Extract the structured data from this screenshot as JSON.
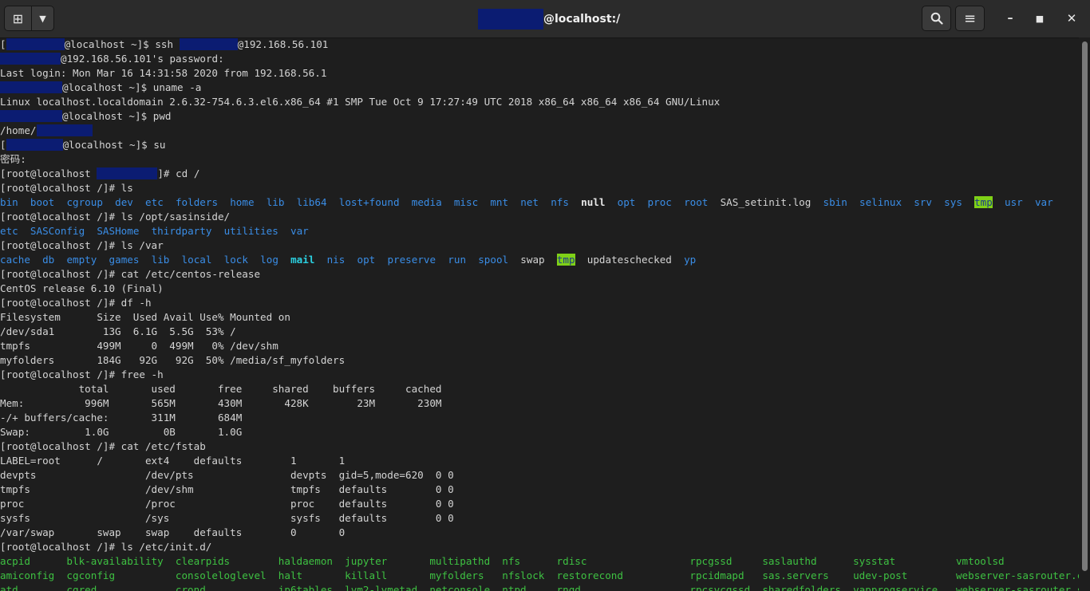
{
  "window": {
    "title": "@localhost:/"
  },
  "titlebar": {
    "new_tab_icon": "new-tab-icon",
    "tab_menu_icon": "chevron-down-icon",
    "search_icon": "search-icon",
    "menu_icon": "hamburger-icon"
  },
  "terminal": {
    "l01_a": "[",
    "l01_b": "@localhost ~]$ ssh ",
    "l01_c": "@192.168.56.101",
    "l02_a": "@192.168.56.101's password:",
    "l03": "Last login: Mon Mar 16 14:31:58 2020 from 192.168.56.1",
    "l04_a": "@localhost ~]$ uname -a",
    "l05": "Linux localhost.localdomain 2.6.32-754.6.3.el6.x86_64 #1 SMP Tue Oct 9 17:27:49 UTC 2018 x86_64 x86_64 x86_64 GNU/Linux",
    "l06_a": "@localhost ~]$ pwd",
    "l07_a": "/home/",
    "l08_a": "[",
    "l08_b": "@localhost ~]$ su",
    "l09": "密码:",
    "l10_a": "[root@localhost ",
    "l10_b": "]# cd /",
    "l11": "[root@localhost /]# ls",
    "ls_root": [
      "bin",
      "boot",
      "cgroup",
      "dev",
      "etc",
      "folders",
      "home",
      "lib",
      "lib64",
      "lost+found",
      "media",
      "misc",
      "mnt",
      "net",
      "nfs"
    ],
    "ls_root_null": "null",
    "ls_root_2": [
      "opt",
      "proc",
      "root"
    ],
    "ls_root_log": "SAS_setinit.log",
    "ls_root_3": [
      "sbin",
      "selinux",
      "srv",
      "sys"
    ],
    "ls_root_tmp": "tmp",
    "ls_root_4": [
      "usr",
      "var"
    ],
    "l13": "[root@localhost /]# ls /opt/sasinside/",
    "ls_sas": [
      "etc",
      "SASConfig",
      "SASHome",
      "thirdparty",
      "utilities",
      "var"
    ],
    "l15": "[root@localhost /]# ls /var",
    "ls_var_1": [
      "cache",
      "db",
      "empty",
      "games",
      "lib",
      "local",
      "lock",
      "log"
    ],
    "ls_var_mail": "mail",
    "ls_var_2": [
      "nis",
      "opt",
      "preserve",
      "run",
      "spool"
    ],
    "ls_var_swap": "swap",
    "ls_var_tmp": "tmp",
    "ls_var_upd": "updateschecked",
    "ls_var_yp": "yp",
    "l17": "[root@localhost /]# cat /etc/centos-release",
    "l18": "CentOS release 6.10 (Final)",
    "l19": "[root@localhost /]# df -h",
    "l20": "Filesystem      Size  Used Avail Use% Mounted on",
    "l21": "/dev/sda1        13G  6.1G  5.5G  53% /",
    "l22": "tmpfs           499M     0  499M   0% /dev/shm",
    "l23": "myfolders       184G   92G   92G  50% /media/sf_myfolders",
    "l24": "[root@localhost /]# free -h",
    "l25": "             total       used       free     shared    buffers     cached",
    "l26": "Mem:          996M       565M       430M       428K        23M       230M",
    "l27": "-/+ buffers/cache:       311M       684M",
    "l28": "Swap:         1.0G         0B       1.0G",
    "l29": "[root@localhost /]# cat /etc/fstab",
    "l30": "LABEL=root      /       ext4    defaults        1       1",
    "l31": "devpts                  /dev/pts                devpts  gid=5,mode=620  0 0",
    "l32": "tmpfs                   /dev/shm                tmpfs   defaults        0 0",
    "l33": "proc                    /proc                   proc    defaults        0 0",
    "l34": "sysfs                   /sys                    sysfs   defaults        0 0",
    "l35": "/var/swap       swap    swap    defaults        0       0",
    "l36": "[root@localhost /]# ls /etc/init.d/",
    "l37": "acpid      blk-availability  clearpids        haldaemon  jupyter       multipathd  nfs      rdisc                 rpcgssd     saslauthd      sysstat          vmtoolsd",
    "l38": "amiconfig  cgconfig          consoleloglevel  halt       killall       myfolders   nfslock  restorecond           rpcidmapd   sas.servers    udev-post        webserver-sasrouter.clearpid",
    "l39": "atd        cgred             crond            ip6tables  lvm2-lvmetad  netconsole  ntpd     rngd                  rpcsvcgssd  sharedfolders  vapprogservice   webserver-sasrouter.server"
  },
  "colors": {
    "background": "#1e1e1e",
    "directory": "#3a8de6",
    "executable": "#3ec142",
    "highlight": "#7fd117",
    "redaction": "#0b1c72"
  }
}
